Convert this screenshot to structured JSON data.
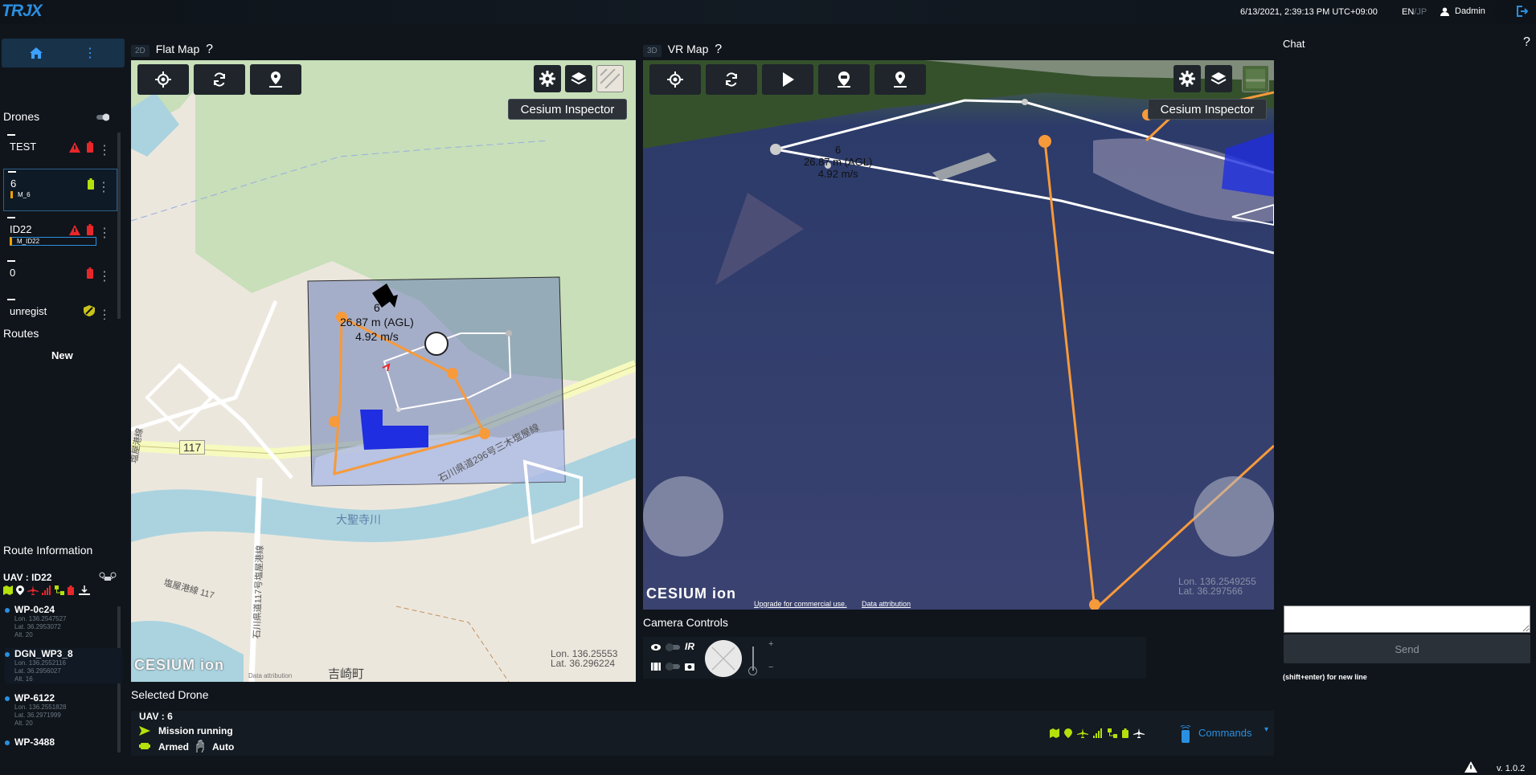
{
  "topbar": {
    "logo": "TRJX",
    "datetime": "6/13/2021, 2:39:13 PM UTC+09:00",
    "lang_active": "EN",
    "lang_sep": "/",
    "lang_inactive": "JP",
    "username": "Dadmin"
  },
  "sidebar": {
    "drones_title": "Drones",
    "drones": [
      {
        "name": "TEST",
        "tag": ""
      },
      {
        "name": "6",
        "tag": "M_6"
      },
      {
        "name": "ID22",
        "tag": "M_ID22"
      },
      {
        "name": "0",
        "tag": ""
      },
      {
        "name": "unregist",
        "tag": ""
      }
    ],
    "routes_title": "Routes",
    "routes_new": "New",
    "route_info_title": "Route Information",
    "uav_label": "UAV : ID22",
    "waypoints": [
      {
        "name": "WP-0c24",
        "lon": "Lon. 136.2547527",
        "lat": "Lat. 36.2953072",
        "alt": "Alt. 20"
      },
      {
        "name": "DGN_WP3_8",
        "lon": "Lon. 136.2552116",
        "lat": "Lat. 36.2956027",
        "alt": "Alt. 16"
      },
      {
        "name": "WP-6122",
        "lon": "Lon. 136.2551828",
        "lat": "Lat. 36.2971999",
        "alt": "Alt. 20"
      },
      {
        "name": "WP-3488",
        "lon": "",
        "lat": "",
        "alt": ""
      }
    ]
  },
  "flatmap": {
    "badge": "2D",
    "title": "Flat Map",
    "help": "?",
    "inspector": "Cesium Inspector",
    "drone_id": "6",
    "drone_alt": "26.87 m (AGL)",
    "drone_speed": "4.92 m/s",
    "road_label": "117",
    "river_label": "大聖寺川",
    "town_label": "吉崎町",
    "road_label2": "石川県道296号三木塩屋線",
    "road_label3": "塩屋港線",
    "road_label4": "石川県道117号塩屋港線",
    "road_label5": "塩屋港線 117",
    "cesium": "CESIUM ion",
    "attribution": "Data attribution",
    "lon": "Lon. 136.25553",
    "lat": "Lat. 36.296224"
  },
  "vrmap": {
    "badge": "3D",
    "title": "VR Map",
    "help": "?",
    "inspector": "Cesium Inspector",
    "drone_id": "6",
    "drone_alt": "26.87 m (AGL)",
    "drone_speed": "4.92 m/s",
    "cesium": "CESIUM ion",
    "upgrade": "Upgrade for commercial use.",
    "attribution": "Data attribution",
    "lon": "Lon. 136.2549255",
    "lat": "Lat. 36.297566"
  },
  "camera": {
    "title": "Camera Controls",
    "ir": "IR",
    "plus": "+",
    "minus": "−"
  },
  "selected": {
    "title": "Selected Drone",
    "uav": "UAV : 6",
    "mission": "Mission running",
    "armed": "Armed",
    "mode": "Auto",
    "commands": "Commands"
  },
  "chat": {
    "title": "Chat",
    "help": "?",
    "send": "Send",
    "hint": "(shift+enter) for new line"
  },
  "version": "v. 1.0.2",
  "colors": {
    "accent": "#2a8fe0",
    "route_orange": "#f79a3a",
    "status_green": "#b4e00b",
    "alert_red": "#e8272a"
  }
}
